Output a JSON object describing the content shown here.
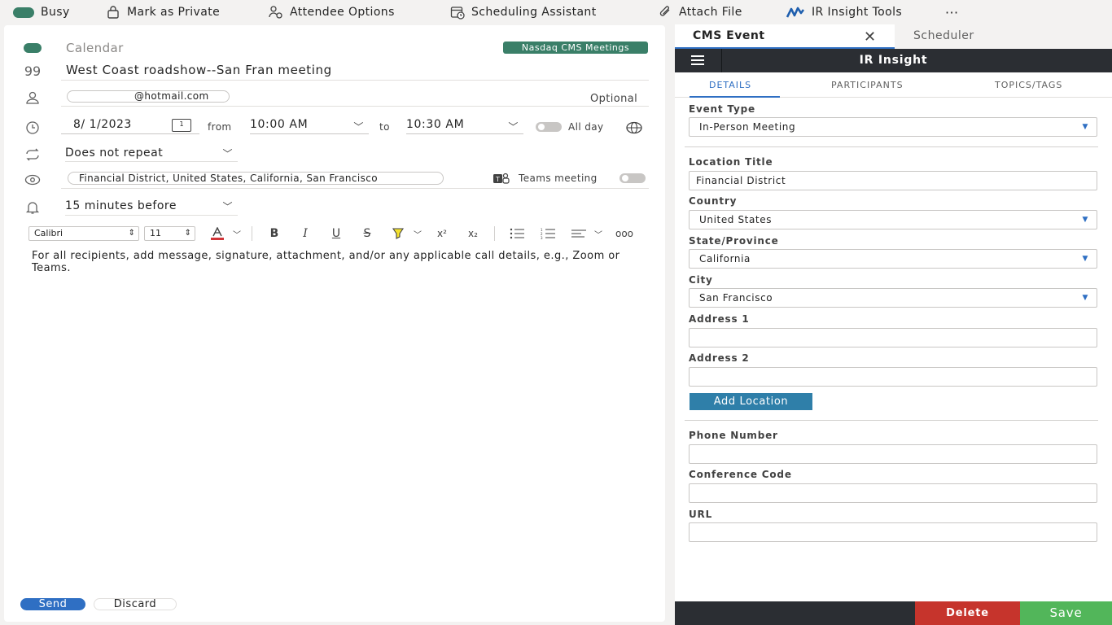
{
  "toolbar": {
    "busy": "Busy",
    "private": "Mark as Private",
    "attendee_options": "Attendee Options",
    "scheduling": "Scheduling Assistant",
    "attach": "Attach File",
    "ir_tools": "IR Insight Tools",
    "more": "···"
  },
  "compose": {
    "calendar_label": "Calendar",
    "category": "Nasdaq CMS Meetings",
    "title": "West Coast roadshow--San Fran meeting",
    "attendee_email": "@hotmail.com",
    "optional": "Optional",
    "date": "8/   1/2023",
    "date_btn": "1",
    "from": "from",
    "start_time": "10:00 AM",
    "to": "to",
    "end_time": "10:30 AM",
    "all_day": "All day",
    "repeat": "Does not repeat",
    "location": "Financial District, United States, California, San Francisco",
    "teams": "Teams meeting",
    "reminder": "15 minutes before",
    "font": "Calibri",
    "font_size": "11",
    "body": "For all recipients, add message, signature, attachment, and/or any applicable call details, e.g., Zoom or Teams.",
    "send": "Send",
    "discard": "Discard"
  },
  "addin": {
    "tab_cms": "CMS Event",
    "tab_scheduler": "Scheduler",
    "header_title": "IR Insight",
    "sub_tabs": [
      "DETAILS",
      "PARTICIPANTS",
      "TOPICS/TAGS"
    ],
    "event_type_label": "Event Type",
    "event_type": "In-Person Meeting",
    "location_title_label": "Location Title",
    "location_title": "Financial District",
    "country_label": "Country",
    "country": "United States",
    "state_label": "State/Province",
    "state": "California",
    "city_label": "City",
    "city": "San Francisco",
    "address1_label": "Address 1",
    "address1": "",
    "address2_label": "Address 2",
    "address2": "",
    "add_location": "Add Location",
    "phone_label": "Phone Number",
    "phone": "",
    "conf_code_label": "Conference Code",
    "conf_code": "",
    "url_label": "URL",
    "url": "",
    "delete": "Delete",
    "save": "Save"
  },
  "colors": {
    "accent": "#2f6fc3",
    "busy": "#3a7f68",
    "delete": "#c6342c",
    "save": "#52b65a",
    "header": "#2b2e33"
  }
}
